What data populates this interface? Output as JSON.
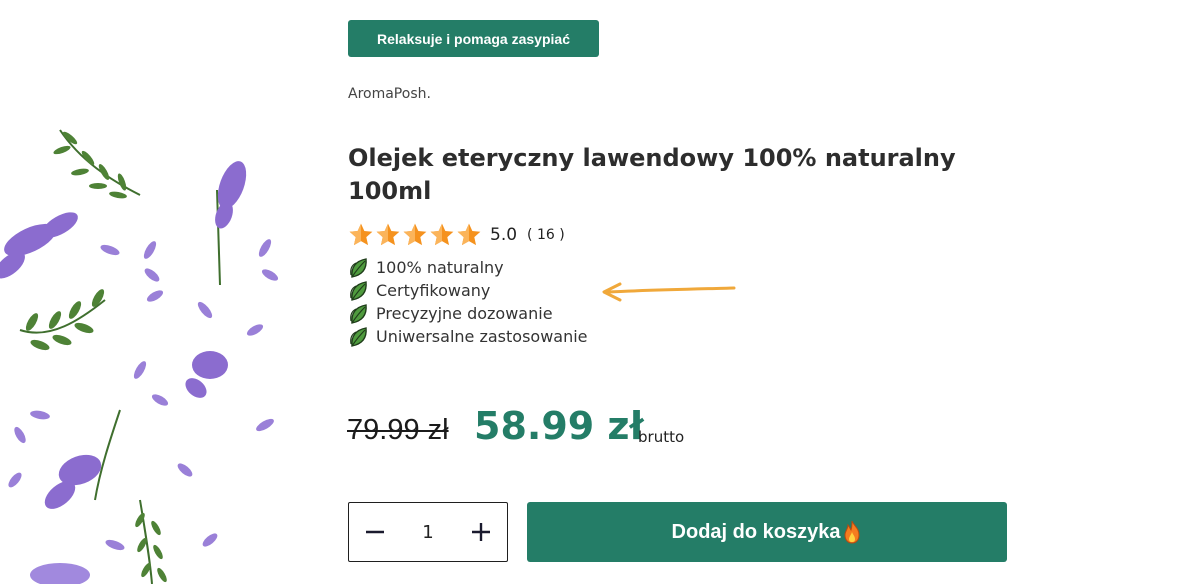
{
  "badge": {
    "label": "Relaksuje i pomaga zasypiać"
  },
  "product": {
    "brand": "AromaPosh.",
    "title": "Olejek eteryczny lawendowy 100% naturalny 100ml",
    "image_icon": "lavender-sprigs-illustration"
  },
  "rating": {
    "value": "5.0",
    "count": "( 16 )",
    "stars": 5,
    "star_color": "#f5921e"
  },
  "features": [
    {
      "label": "100% naturalny",
      "icon": "leaf-icon"
    },
    {
      "label": "Certyfikowany",
      "icon": "leaf-icon"
    },
    {
      "label": "Precyzyjne dozowanie",
      "icon": "leaf-icon"
    },
    {
      "label": "Uniwersalne zastosowanie",
      "icon": "leaf-icon"
    }
  ],
  "price": {
    "old": "79.99 zł",
    "current": "58.99 zł",
    "suffix": "brutto"
  },
  "quantity": {
    "value": "1",
    "decrement_icon": "minus-icon",
    "increment_icon": "plus-icon"
  },
  "cart": {
    "label": "Dodaj do koszyka",
    "icon": "fire-icon"
  },
  "colors": {
    "accent": "#247d67",
    "star": "#f5921e",
    "annotation_arrow": "#f0a83a",
    "lavender": "#8b6ccf"
  }
}
